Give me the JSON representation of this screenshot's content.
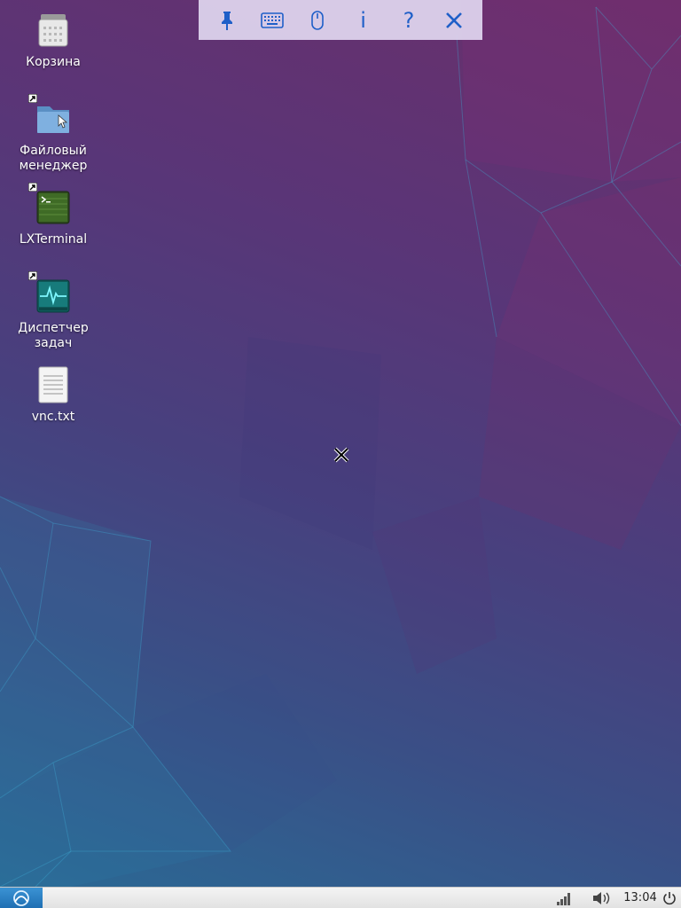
{
  "desktop": {
    "icons": [
      {
        "label": "Корзина",
        "icon": "trash-icon"
      },
      {
        "label": "Файловый\nменеджер",
        "icon": "folder-icon"
      },
      {
        "label": "LXTerminal",
        "icon": "terminal-icon"
      },
      {
        "label": "Диспетчер\nзадач",
        "icon": "task-manager-icon"
      },
      {
        "label": "vnc.txt",
        "icon": "text-file-icon"
      }
    ]
  },
  "vnc_toolbar": {
    "buttons": [
      {
        "name": "pin",
        "icon": "pin-icon"
      },
      {
        "name": "keyboard",
        "icon": "keyboard-icon"
      },
      {
        "name": "mouse",
        "icon": "mouse-icon"
      },
      {
        "name": "info",
        "icon": "info-icon",
        "glyph": "i"
      },
      {
        "name": "help",
        "icon": "help-icon",
        "glyph": "?"
      },
      {
        "name": "close",
        "icon": "close-icon"
      }
    ],
    "accent": "#1f5fc8"
  },
  "taskbar": {
    "clock": "13:04",
    "tray": [
      "network-signal-icon",
      "volume-icon",
      "power-icon"
    ]
  }
}
